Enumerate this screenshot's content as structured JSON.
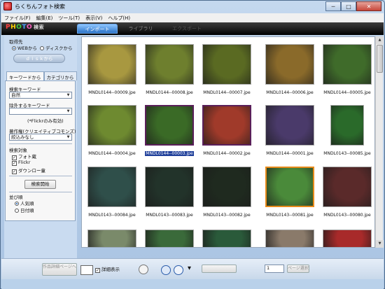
{
  "window": {
    "title": "らくちんフォト検索",
    "controls": {
      "minimize": "─",
      "maximize": "□",
      "close": "✕"
    }
  },
  "menu": [
    "ファイル(F)",
    "編集(E)",
    "ツール(T)",
    "表示(V)",
    "ヘルプ(H)"
  ],
  "header": {
    "logo_letters": [
      "P",
      "H",
      "O",
      "T",
      "O"
    ],
    "logo_sub": "検索",
    "tabs": [
      {
        "label": "インポート",
        "state": "active"
      },
      {
        "label": "ライブラリ",
        "state": "inactive"
      },
      {
        "label": "エクスポート",
        "state": "disabled"
      }
    ]
  },
  "sidebar": {
    "source_label": "取得先",
    "source_options": [
      "WEBから",
      "ディスクから"
    ],
    "source_selected": 0,
    "disk_button": "ｄｉｓｋから",
    "sub_tabs": [
      "キーワードから",
      "カテゴリから"
    ],
    "search_keyword_label": "検索キーワード",
    "search_keyword_value": "自然",
    "exclude_label": "除外するキーワード",
    "exclude_value": "",
    "flickr_note": "(*Flickrのみ有効)",
    "license_label": "著作権(クリエイティブコモンズ)",
    "license_value": "絞込みなし",
    "target_label": "検索対象",
    "targets": [
      {
        "label": "フォト蔵",
        "checked": true
      },
      {
        "label": "Flickr",
        "checked": true
      },
      {
        "label": "ダウンロー童",
        "checked": true
      }
    ],
    "search_button": "検索開始",
    "sort_label": "並び順",
    "sort_options": [
      "人気順",
      "日付順"
    ],
    "sort_selected": 0
  },
  "grid": {
    "items": [
      {
        "caption": "MNDL0144--00009.jpe"
      },
      {
        "caption": "MNDL0144--00008.jpe"
      },
      {
        "caption": "MNDL0144--00007.jpe"
      },
      {
        "caption": "MNDL0144--00006.jpe"
      },
      {
        "caption": "MNDL0144--00005.jpe"
      },
      {
        "caption": "MNDL0144--00004.jpe"
      },
      {
        "caption": "MNDL0144--00003.jpe",
        "selected": true
      },
      {
        "caption": "MNDL0144--00002.jpe"
      },
      {
        "caption": "MNDL0144--00001.jpe"
      },
      {
        "caption": "MNDL0143--00085.jpe"
      },
      {
        "caption": "MNDL0143--00084.jpe"
      },
      {
        "caption": "MNDL0143--00083.jpe"
      },
      {
        "caption": "MNDL0143--00082.jpe"
      },
      {
        "caption": "MNDL0143--00081.jpe"
      },
      {
        "caption": "MNDL0143--00080.jpe"
      },
      {
        "caption": ""
      },
      {
        "caption": ""
      },
      {
        "caption": ""
      },
      {
        "caption": ""
      },
      {
        "caption": ""
      }
    ],
    "colors": [
      "#a89840",
      "#6e7f2e",
      "#5a6a22",
      "#8a6a2a",
      "#3f6b2a",
      "#6e8a30",
      "#3a6a26",
      "#a03a2a",
      "#4a3a6a",
      "#2a6a2a",
      "#2f4f4a",
      "#22332a",
      "#1f2a1f",
      "#4a8a3a",
      "#5a2a2a",
      "#7a8a6a",
      "#3a6a3a",
      "#2a5a3a",
      "#8a7a6a",
      "#a82a2a"
    ]
  },
  "statusbar": {
    "detail_view_btn": "作品詳細ページへ",
    "detail_display_label": "詳細表示",
    "page_value": "1",
    "page_select_btn": "ページ選択"
  }
}
